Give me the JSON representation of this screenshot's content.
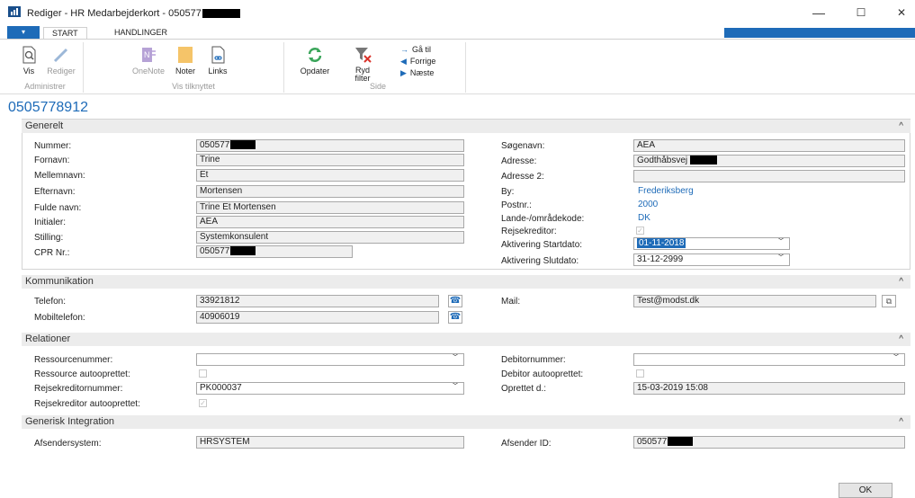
{
  "window": {
    "title": "Rediger - HR Medarbejderkort - 050577",
    "minimize": "—",
    "maximize": "☐",
    "close": "✕"
  },
  "ribbon": {
    "menu_arrow": "▾",
    "tabs": [
      "START",
      "HANDLINGER"
    ],
    "buttons": {
      "vis": "Vis",
      "rediger": "Rediger",
      "onenote": "OneNote",
      "noter": "Noter",
      "links": "Links",
      "opdater": "Opdater",
      "ryd_filter_1": "Ryd",
      "ryd_filter_2": "filter"
    },
    "nav": {
      "gaa_til": "Gå til",
      "forrige": "Forrige",
      "naeste": "Næste"
    },
    "groups": {
      "administrer": "Administrer",
      "vis_tilknyttet": "Vis tilknyttet",
      "side": "Side"
    }
  },
  "page_title": "0505778912",
  "sections": {
    "generelt": {
      "title": "Generelt",
      "chevron": "^",
      "left": [
        {
          "label": "Nummer:",
          "value": "050577"
        },
        {
          "label": "Fornavn:",
          "value": "Trine"
        },
        {
          "label": "Mellemnavn:",
          "value": "Et"
        },
        {
          "label": "Efternavn:",
          "value": "Mortensen"
        },
        {
          "label": "Fulde navn:",
          "value": "Trine Et Mortensen"
        },
        {
          "label": "Initialer:",
          "value": "AEA"
        },
        {
          "label": "Stilling:",
          "value": "Systemkonsulent"
        },
        {
          "label": "CPR Nr.:",
          "value": "050577"
        }
      ],
      "right": {
        "soegenavn_label": "Søgenavn:",
        "soegenavn": "AEA",
        "adresse_label": "Adresse:",
        "adresse": "Godthåbsvej",
        "adresse2_label": "Adresse 2:",
        "adresse2": "",
        "by_label": "By:",
        "by": "Frederiksberg",
        "postnr_label": "Postnr.:",
        "postnr": "2000",
        "lande_label": "Lande-/områdekode:",
        "lande": "DK",
        "rejsekreditor_label": "Rejsekreditor:",
        "start_label": "Aktivering Startdato:",
        "start": "01-11-2018",
        "slut_label": "Aktivering Slutdato:",
        "slut": "31-12-2999"
      }
    },
    "kommunikation": {
      "title": "Kommunikation",
      "chevron": "^",
      "telefon_label": "Telefon:",
      "telefon": "33921812",
      "mobil_label": "Mobiltelefon:",
      "mobil": "40906019",
      "mail_label": "Mail:",
      "mail": "Test@modst.dk"
    },
    "relationer": {
      "title": "Relationer",
      "chevron": "^",
      "ressourcenummer_label": "Ressourcenummer:",
      "ressourcenummer": "",
      "ressource_auto_label": "Ressource autooprettet:",
      "rejsekreditornummer_label": "Rejsekreditornummer:",
      "rejsekreditornummer": "PK000037",
      "rejsekreditor_auto_label": "Rejsekreditor autooprettet:",
      "debitornummer_label": "Debitornummer:",
      "debitornummer": "",
      "debitor_auto_label": "Debitor autooprettet:",
      "oprettet_label": "Oprettet d.:",
      "oprettet": "15-03-2019 15:08"
    },
    "generisk": {
      "title": "Generisk Integration",
      "chevron": "^",
      "afsendersystem_label": "Afsendersystem:",
      "afsendersystem": "HRSYSTEM",
      "afsender_id_label": "Afsender ID:",
      "afsender_id": "050577"
    }
  },
  "footer": {
    "ok": "OK"
  },
  "colors": {
    "accent": "#1e6bb8",
    "section_bg": "#ececec",
    "field_bg": "#f0f0f0"
  }
}
